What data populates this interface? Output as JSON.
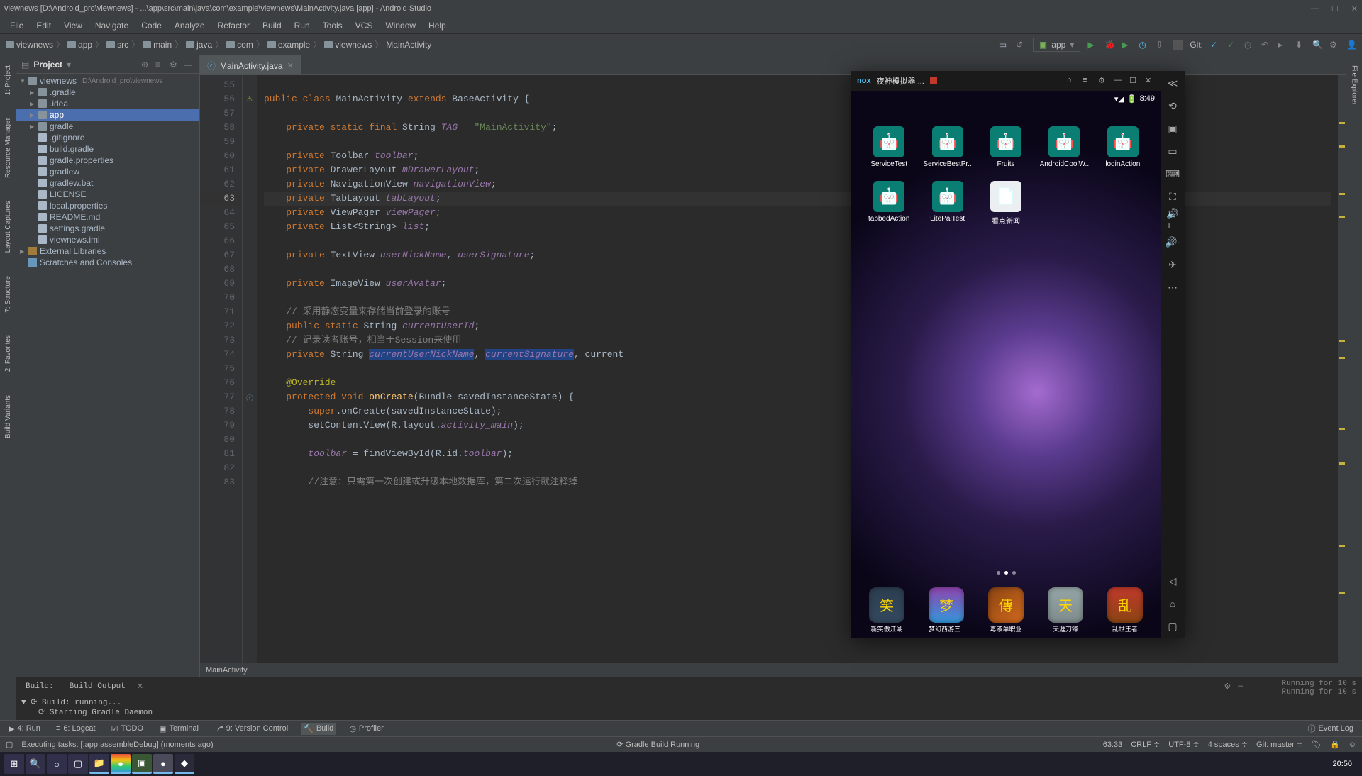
{
  "window": {
    "title": "viewnews [D:\\Android_pro\\viewnews] - ...\\app\\src\\main\\java\\com\\example\\viewnews\\MainActivity.java [app] - Android Studio"
  },
  "menu": [
    "File",
    "Edit",
    "View",
    "Navigate",
    "Code",
    "Analyze",
    "Refactor",
    "Build",
    "Run",
    "Tools",
    "VCS",
    "Window",
    "Help"
  ],
  "breadcrumb": [
    "viewnews",
    "app",
    "src",
    "main",
    "java",
    "com",
    "example",
    "viewnews",
    "MainActivity"
  ],
  "run_config": "app",
  "git_label": "Git:",
  "project_panel": {
    "title": "Project"
  },
  "left_rail": [
    "1: Project",
    "Resource Manager",
    "Layout Captures",
    "7: Structure",
    "2: Favorites",
    "Build Variants"
  ],
  "right_rail": [
    "File Explorer"
  ],
  "tree": {
    "root": "viewnews",
    "root_path": "D:\\Android_pro\\viewnews",
    "items": [
      {
        "name": ".gradle",
        "indent": 1,
        "arrow": "▶",
        "type": "folder"
      },
      {
        "name": ".idea",
        "indent": 1,
        "arrow": "▶",
        "type": "folder"
      },
      {
        "name": "app",
        "indent": 1,
        "arrow": "▶",
        "type": "folder",
        "selected": true
      },
      {
        "name": "gradle",
        "indent": 1,
        "arrow": "▶",
        "type": "folder"
      },
      {
        "name": ".gitignore",
        "indent": 1,
        "arrow": "",
        "type": "file"
      },
      {
        "name": "build.gradle",
        "indent": 1,
        "arrow": "",
        "type": "file"
      },
      {
        "name": "gradle.properties",
        "indent": 1,
        "arrow": "",
        "type": "file"
      },
      {
        "name": "gradlew",
        "indent": 1,
        "arrow": "",
        "type": "file"
      },
      {
        "name": "gradlew.bat",
        "indent": 1,
        "arrow": "",
        "type": "file"
      },
      {
        "name": "LICENSE",
        "indent": 1,
        "arrow": "",
        "type": "file"
      },
      {
        "name": "local.properties",
        "indent": 1,
        "arrow": "",
        "type": "file"
      },
      {
        "name": "README.md",
        "indent": 1,
        "arrow": "",
        "type": "file"
      },
      {
        "name": "settings.gradle",
        "indent": 1,
        "arrow": "",
        "type": "file"
      },
      {
        "name": "viewnews.iml",
        "indent": 1,
        "arrow": "",
        "type": "file"
      }
    ],
    "ext_libs": "External Libraries",
    "scratches": "Scratches and Consoles"
  },
  "editor": {
    "tab": "MainActivity.java",
    "breadcrumb_bottom": "MainActivity",
    "first_line": 55,
    "current_line": 63
  },
  "build": {
    "header_build": "Build:",
    "header_output": "Build Output",
    "line1": "Build: running...",
    "line2": "Starting Gradle Daemon",
    "timing": "Running for 10 s"
  },
  "bottom_tools": {
    "run": "4: Run",
    "logcat": "6: Logcat",
    "todo": "TODO",
    "terminal": "Terminal",
    "vcs": "9: Version Control",
    "build": "Build",
    "profiler": "Profiler",
    "eventlog": "Event Log"
  },
  "status": {
    "task": "Executing tasks: [:app:assembleDebug] (moments ago)",
    "center": "Gradle Build Running",
    "pos": "63:33",
    "sep": "CRLF",
    "enc": "UTF-8",
    "spaces": "4 spaces",
    "git": "Git: master"
  },
  "taskbar": {
    "clock": "20:50"
  },
  "emulator": {
    "brand": "nox",
    "title": "夜神模拟器 ...",
    "status_time": "8:49",
    "apps_row1": [
      "ServiceTest",
      "ServiceBestPr..",
      "Fruits",
      "AndroidCoolW..",
      "loginAction"
    ],
    "apps_row2": [
      "tabbedAction",
      "LitePalTest",
      "看点新闻"
    ],
    "dock": [
      "新笑傲江湖",
      "梦幻西游三..",
      "毒液单职业",
      "天涯刀锋",
      "乱世王者"
    ]
  }
}
